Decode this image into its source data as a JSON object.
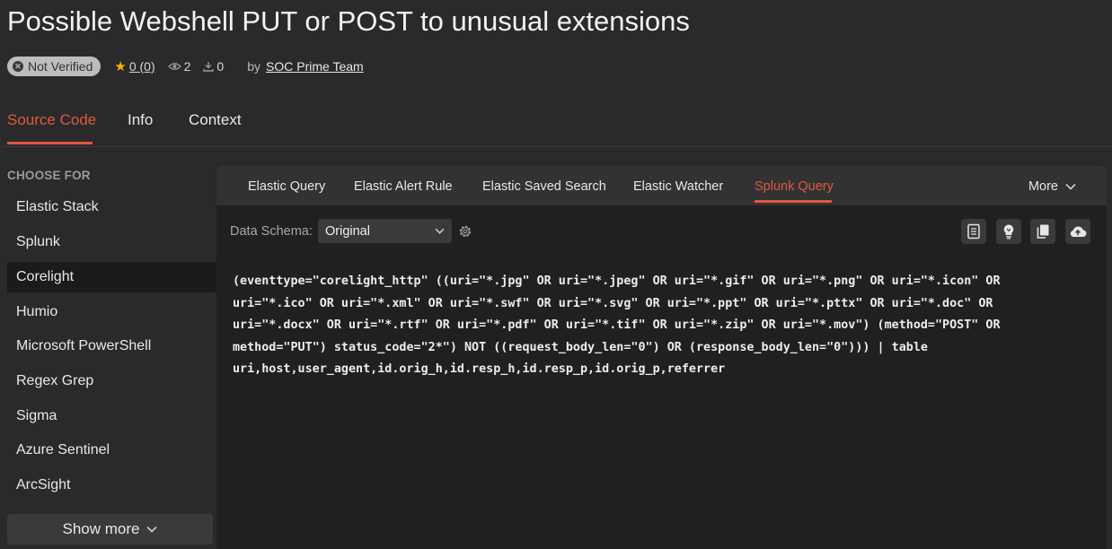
{
  "page": {
    "title": "Possible Webshell PUT or POST to unusual extensions",
    "badge": "Not Verified",
    "rating": "0 (0)",
    "views": "2",
    "downloads": "0",
    "by_label": "by",
    "author": "SOC Prime Team"
  },
  "tabs": [
    "Source Code",
    "Info",
    "Context"
  ],
  "sidebar": {
    "heading": "CHOOSE FOR",
    "items": [
      "Elastic Stack",
      "Splunk",
      "Corelight",
      "Humio",
      "Microsoft PowerShell",
      "Regex Grep",
      "Sigma",
      "Azure Sentinel",
      "ArcSight"
    ],
    "active": "Corelight",
    "show_more": "Show more"
  },
  "panel": {
    "tabs": [
      "Elastic Query",
      "Elastic Alert Rule",
      "Elastic Saved Search",
      "Elastic Watcher",
      "Splunk Query"
    ],
    "active_tab": "Splunk Query",
    "more": "More",
    "schema_label": "Data Schema:",
    "schema_value": "Original",
    "code_lines": [
      "(eventtype=\"corelight_http\" ((uri=\"*.jpg\" OR uri=\"*.jpeg\" OR uri=\"*.gif\" OR uri=\"*.png\" OR uri=\"*.icon\" OR",
      "uri=\"*.ico\" OR uri=\"*.xml\" OR uri=\"*.swf\" OR uri=\"*.svg\" OR uri=\"*.ppt\" OR uri=\"*.pttx\" OR uri=\"*.doc\" OR",
      "uri=\"*.docx\" OR uri=\"*.rtf\" OR uri=\"*.pdf\" OR uri=\"*.tif\" OR uri=\"*.zip\" OR uri=\"*.mov\") (method=\"POST\" OR",
      "method=\"PUT\") status_code=\"2*\") NOT ((request_body_len=\"0\") OR (response_body_len=\"0\"))) | table",
      "uri,host,user_agent,id.orig_h,id.resp_h,id.resp_p,id.orig_p,referrer"
    ]
  },
  "icons": [
    "not-verified-icon",
    "star-icon",
    "eye-icon",
    "download-icon",
    "chevron-down-icon",
    "gear-icon",
    "notebook-icon",
    "lightbulb-icon",
    "copy-icon",
    "cloud-upload-icon"
  ],
  "colors": {
    "background": "#2a2a2b",
    "panel": "#202021",
    "accent": "#e0583f",
    "star": "#f5b400"
  }
}
